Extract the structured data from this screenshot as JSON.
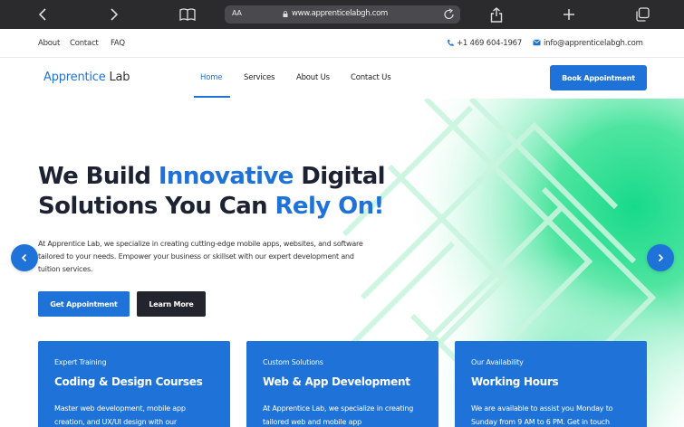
{
  "browser": {
    "text_size_label": "AA",
    "url": "www.apprenticelabgh.com"
  },
  "topbar": {
    "links": [
      "About",
      "Contact",
      "FAQ"
    ],
    "phone": "+1 469 604-1967",
    "email": "info@apprenticelabgh.com"
  },
  "nav": {
    "logo_part1": "Apprentice",
    "logo_part2": "Lab",
    "items": [
      "Home",
      "Services",
      "About Us",
      "Contact Us"
    ],
    "active": "Home",
    "cta": "Book Appointment"
  },
  "hero": {
    "headline_1": "We Build ",
    "headline_highlight_1": "Innovative",
    "headline_2": " Digital",
    "headline_3": "Solutions You Can ",
    "headline_highlight_2": "Rely On!",
    "paragraph": "At Apprentice Lab, we specialize in creating cutting-edge mobile apps, websites, and software tailored to your needs. Empower your business or skillset with our expert development and tuition services.",
    "primary_button": "Get Appointment",
    "secondary_button": "Learn More"
  },
  "cards": [
    {
      "eyebrow": "Expert Training",
      "title": "Coding & Design Courses",
      "text": "Master web development, mobile app creation, and UX/UI design with our"
    },
    {
      "eyebrow": "Custom Solutions",
      "title": "Web & App Development",
      "text": "At Apprentice Lab, we specialize in creating tailored web and mobile app"
    },
    {
      "eyebrow": "Our Availability",
      "title": "Working Hours",
      "text": "We are available to assist you Monday to Sunday from 9 AM to 6 PM. Get in touch"
    }
  ],
  "colors": {
    "accent": "#1f73d8",
    "dark": "#1d2233",
    "hero_glow": "#2fe08f"
  }
}
